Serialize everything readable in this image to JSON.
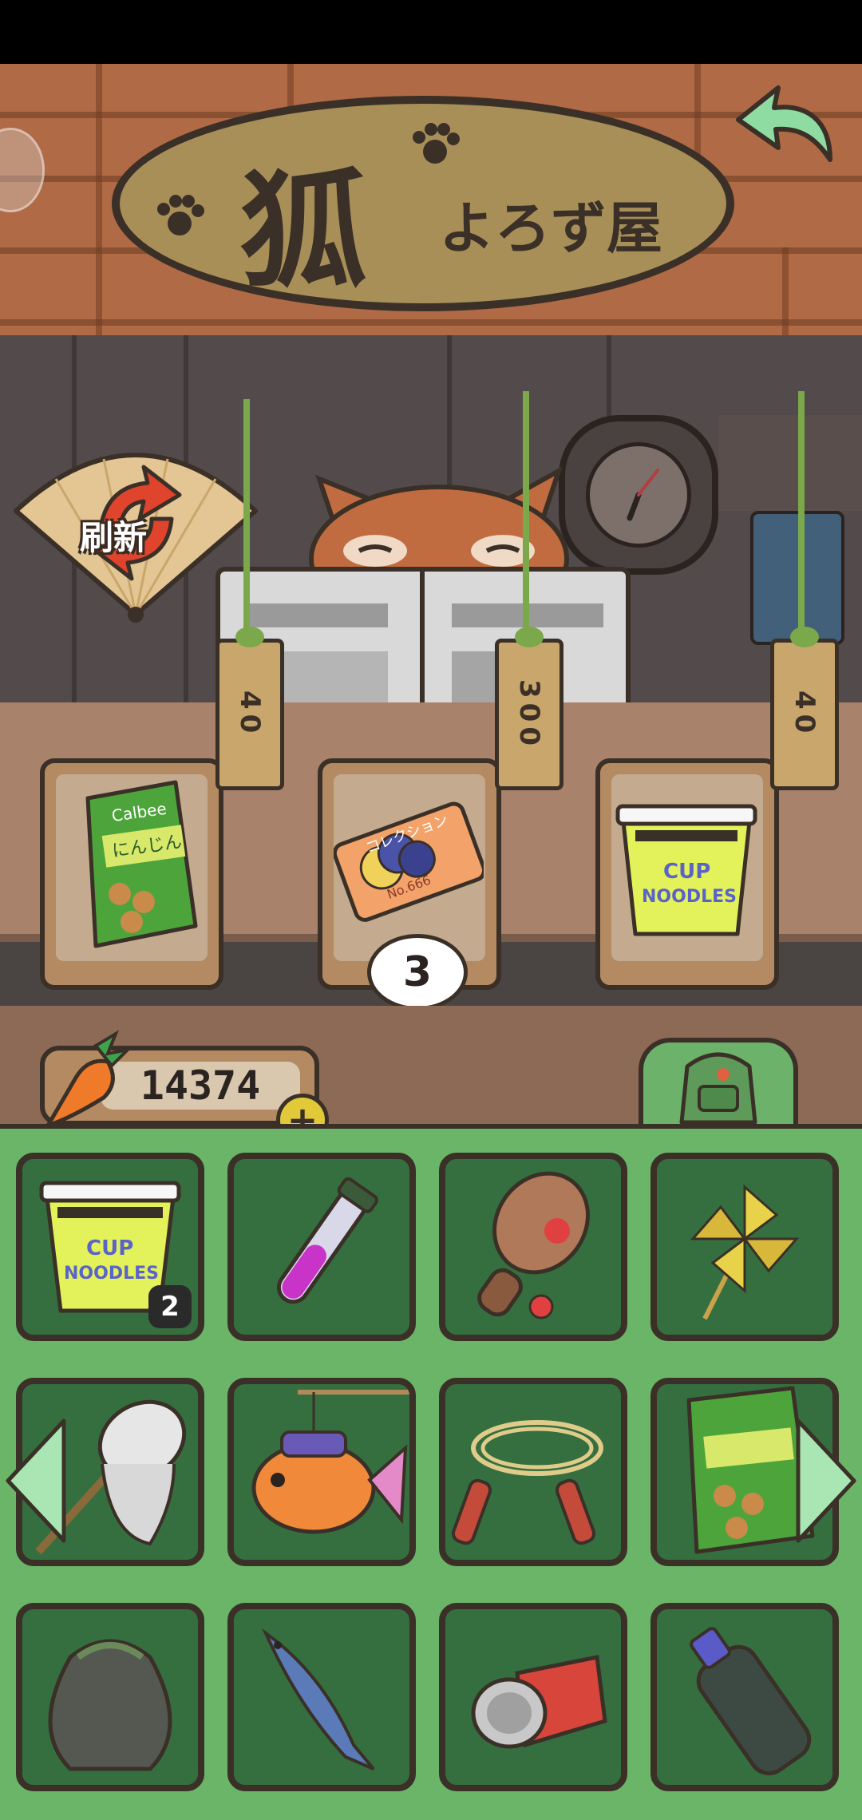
{
  "shop": {
    "sign_main": "狐",
    "sign_sub": "よろず屋",
    "refresh_label": "刷新",
    "slots": [
      {
        "item": "carrot-snack-bag",
        "price": "40"
      },
      {
        "item": "collection-ticket",
        "price": "300",
        "stock": "3"
      },
      {
        "item": "cup-noodles",
        "price": "40"
      }
    ]
  },
  "currency": {
    "value": "14374",
    "add_label": "+"
  },
  "inventory": {
    "items": [
      {
        "name": "cup-noodles",
        "count": "2"
      },
      {
        "name": "potion-vial"
      },
      {
        "name": "paddle-ball"
      },
      {
        "name": "pinwheel"
      },
      {
        "name": "bug-net"
      },
      {
        "name": "goldfish-lantern"
      },
      {
        "name": "jump-rope"
      },
      {
        "name": "carrot-snack-bag"
      },
      {
        "name": "trash-bag"
      },
      {
        "name": "sardine"
      },
      {
        "name": "crushed-can"
      },
      {
        "name": "plastic-bottle"
      }
    ]
  },
  "ticket_text": {
    "title": "コレクション",
    "number": "No.666"
  },
  "noodle_text": {
    "line1": "CUP",
    "line2": "NOODLES"
  },
  "snack_text": {
    "brand": "Calbee",
    "name": "にんじん"
  },
  "colors": {
    "inventory_bg": "#6ab568",
    "slot_bg": "#356f3f",
    "outline": "#3a3027",
    "roof": "#b06a45"
  }
}
